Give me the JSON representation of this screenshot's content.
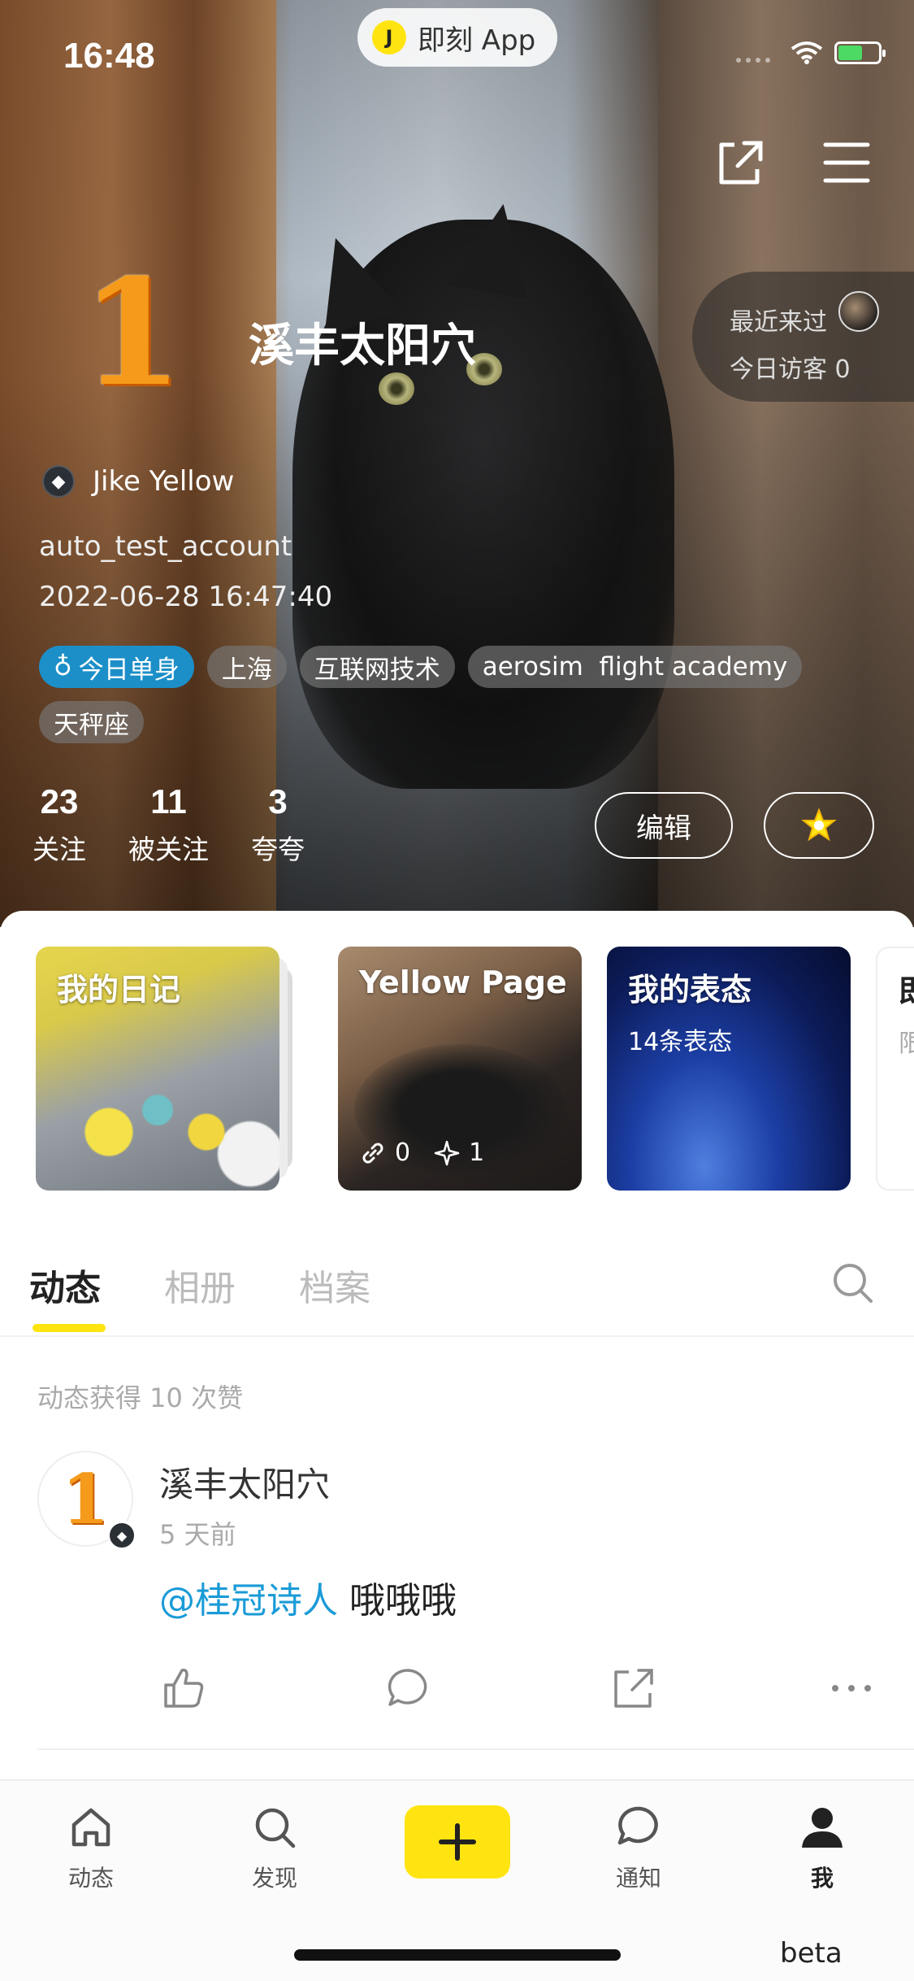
{
  "status_bar": {
    "time": "16:48",
    "app_pill_label": "即刻 App",
    "battery_level": 0.6,
    "battery_color": "#4cd964"
  },
  "profile": {
    "level_glyph": "1",
    "nickname": "溪丰太阳穴",
    "visitors": {
      "recent_label": "最近来过",
      "today_label": "今日访客 0"
    },
    "badge_label": "Jike Yellow",
    "account_id": "auto_test_account",
    "joined_at": "2022-06-28 16:47:40",
    "tags": [
      "今日单身",
      "上海",
      "互联网技术",
      "aerosim  flight academy",
      "天秤座"
    ],
    "stats": [
      {
        "num": "23",
        "label": "关注"
      },
      {
        "num": "11",
        "label": "被关注"
      },
      {
        "num": "3",
        "label": "夸夸"
      }
    ],
    "edit_button": "编辑"
  },
  "cards": [
    {
      "title": "我的日记",
      "subtitle": ""
    },
    {
      "title": "Yellow Page",
      "links": "0",
      "stars": "1"
    },
    {
      "title": "我的表态",
      "subtitle": "14条表态"
    },
    {
      "title": "即",
      "subtitle": "限"
    }
  ],
  "tabs": [
    "动态",
    "相册",
    "档案"
  ],
  "feed": {
    "likes_summary": "动态获得 10 次赞",
    "post": {
      "avatar_glyph": "1",
      "author": "溪丰太阳穴",
      "time": "5 天前",
      "mention": "@桂冠诗人",
      "text": " 哦哦哦"
    }
  },
  "bottom_nav": [
    {
      "label": "动态"
    },
    {
      "label": "发现"
    },
    {
      "label": "通知"
    },
    {
      "label": "我"
    }
  ],
  "beta_label": "beta",
  "colors": {
    "accent_yellow": "#ffe411",
    "mention_blue": "#1a9bd7",
    "tag_single_blue": "#1c8fc8"
  }
}
